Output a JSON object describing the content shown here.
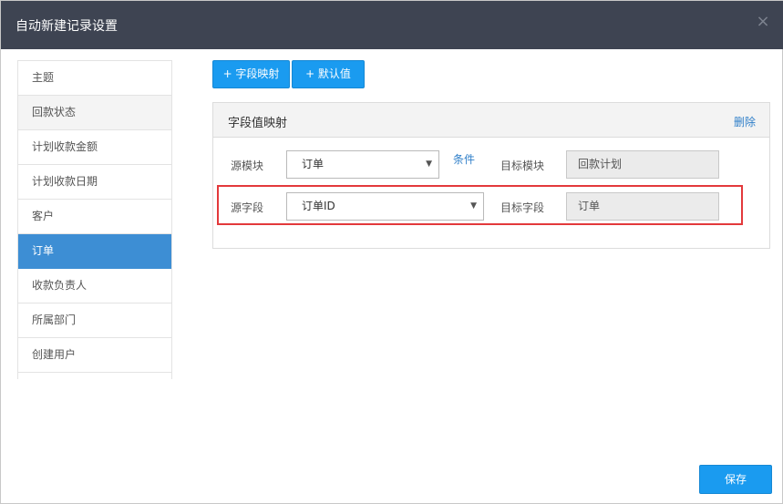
{
  "dialog": {
    "title": "自动新建记录设置",
    "close_glyph": "×"
  },
  "sidebar": {
    "items": [
      {
        "label": "主题"
      },
      {
        "label": "回款状态"
      },
      {
        "label": "计划收款金额"
      },
      {
        "label": "计划收款日期"
      },
      {
        "label": "客户"
      },
      {
        "label": "订单"
      },
      {
        "label": "收款负责人"
      },
      {
        "label": "所属部门"
      },
      {
        "label": "创建用户"
      }
    ],
    "selected": "订单"
  },
  "toolbar": {
    "field_mapping_label": "+ 字段映射",
    "default_value_label": "+ 默认值"
  },
  "panel": {
    "title": "字段值映射",
    "delete_label": "删除",
    "row1": {
      "source_module_label": "源模块",
      "source_module_value": "订单",
      "condition_label": "条件",
      "target_module_label": "目标模块",
      "target_module_value": "回款计划"
    },
    "row2": {
      "source_field_label": "源字段",
      "source_field_value": "订单ID",
      "target_field_label": "目标字段",
      "target_field_value": "订单"
    }
  },
  "footer": {
    "save_label": "保存"
  },
  "colors": {
    "titlebar": "#3e4452",
    "accent": "#1a9bf0",
    "sidebar_active": "#3d8ed4",
    "highlight": "#e3393b"
  },
  "icons": {
    "close": "close-icon",
    "dropdown": "caret-down-icon"
  }
}
